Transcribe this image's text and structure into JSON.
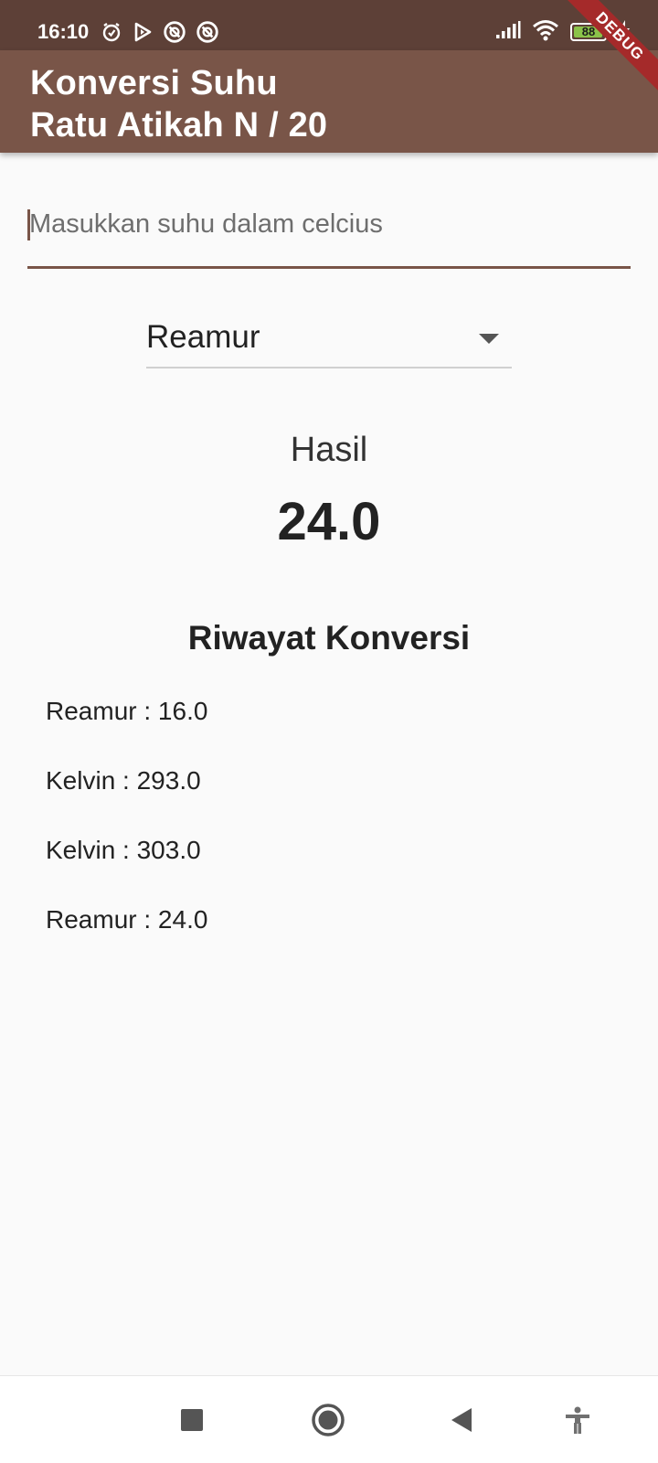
{
  "status_bar": {
    "time": "16:10",
    "battery_level": "88",
    "icons": [
      "alarm-icon",
      "play-icon",
      "blocked-icon",
      "blocked-icon",
      "signal-icon",
      "wifi-icon",
      "battery-icon",
      "charging-icon"
    ]
  },
  "app_bar": {
    "title": "Konversi Suhu\nRatu Atikah N / 20",
    "background_color": "#795548",
    "status_color": "#5d4037"
  },
  "debug_banner": "DEBUG",
  "input": {
    "value": "",
    "placeholder": "Masukkan suhu dalam celcius"
  },
  "dropdown": {
    "selected": "Reamur"
  },
  "result": {
    "label": "Hasil",
    "value": "24.0"
  },
  "history": {
    "title": "Riwayat Konversi",
    "items": [
      "Reamur : 16.0",
      "Kelvin : 293.0",
      "Kelvin : 303.0",
      "Reamur : 24.0"
    ]
  },
  "nav_bar": {
    "icons": [
      "recents-square-icon",
      "home-circle-icon",
      "back-triangle-icon",
      "accessibility-icon"
    ]
  }
}
